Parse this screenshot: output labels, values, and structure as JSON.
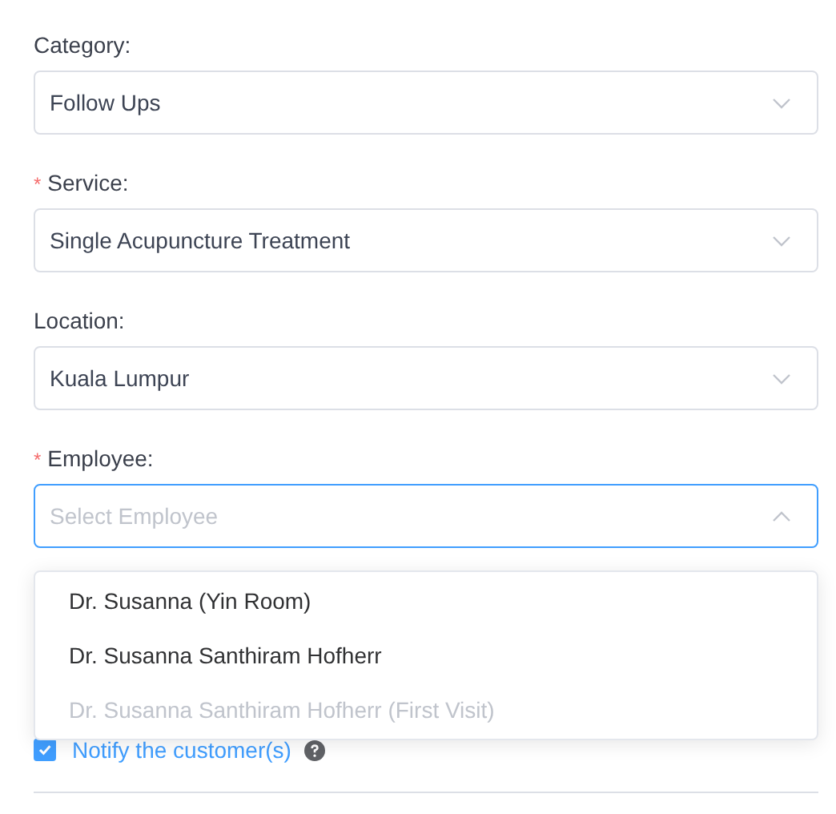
{
  "fields": [
    {
      "label": "Category:",
      "value": "Follow Ups",
      "open": false
    },
    {
      "label": "Service:",
      "required_mark": "*",
      "value": "Single Acupuncture Treatment",
      "open": false
    },
    {
      "label": "Location:",
      "value": "Kuala Lumpur",
      "open": false
    },
    {
      "label": "Employee:",
      "required_mark": "*",
      "placeholder": "Select Employee",
      "open": true,
      "options": [
        {
          "label": "Dr. Susanna (Yin Room)",
          "disabled": false
        },
        {
          "label": "Dr. Susanna Santhiram Hofherr",
          "disabled": false
        },
        {
          "label": "Dr. Susanna Santhiram Hofherr (First Visit)",
          "disabled": true
        }
      ]
    }
  ],
  "notify": {
    "label": "Notify the customer(s)",
    "checked": true
  }
}
